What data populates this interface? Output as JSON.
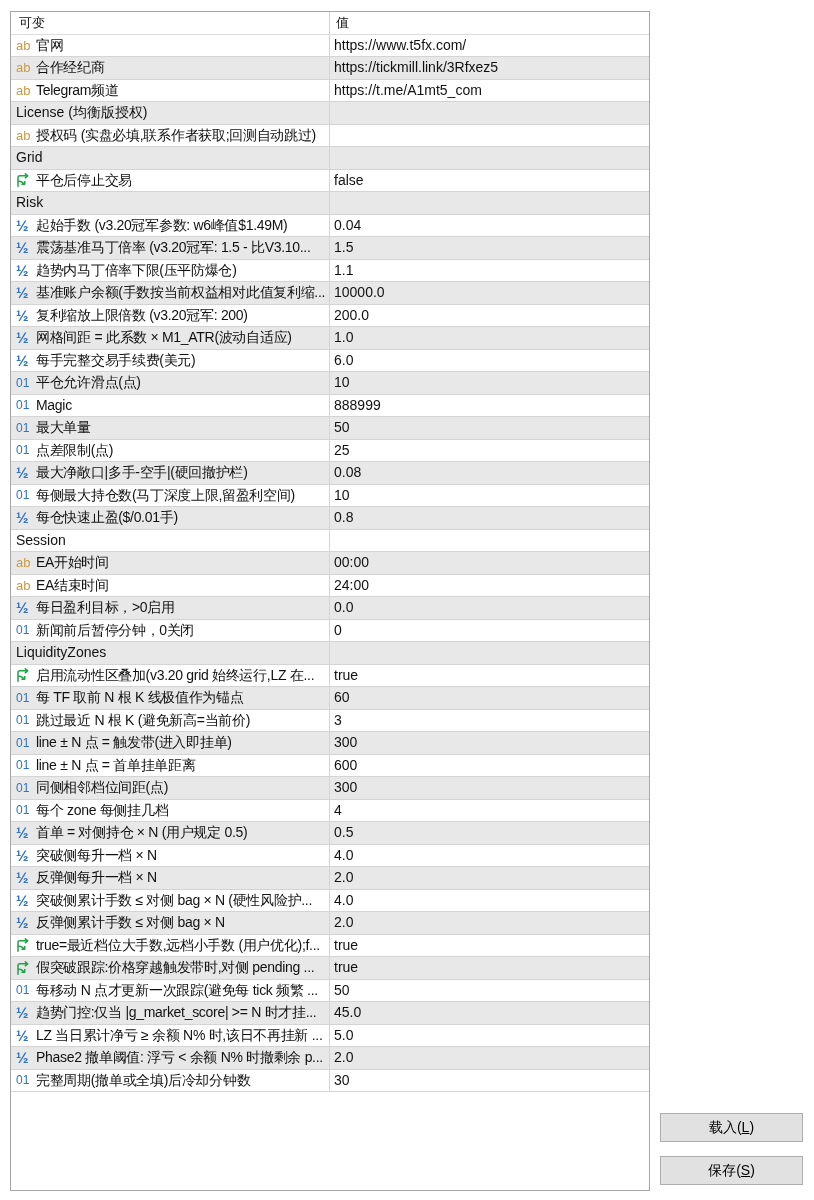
{
  "columns": [
    {
      "label": "可变"
    },
    {
      "label": "值"
    }
  ],
  "rows": [
    {
      "kind": "text",
      "type_glyph": "ab",
      "name": "官网",
      "value": "https://www.t5fx.com/"
    },
    {
      "kind": "text",
      "type_glyph": "ab",
      "name": "合作经纪商",
      "value": "https://tickmill.link/3Rfxez5"
    },
    {
      "kind": "text",
      "type_glyph": "ab",
      "name": "Telegram频道",
      "value": "https://t.me/A1mt5_com"
    },
    {
      "kind": "group",
      "name": "License (均衡版授权)"
    },
    {
      "kind": "text",
      "type_glyph": "ab",
      "name": "授权码 (实盘必填,联系作者获取;回测自动跳过)"
    },
    {
      "kind": "group",
      "name": "Grid"
    },
    {
      "kind": "boolean",
      "name": "平仓后停止交易",
      "value": "false"
    },
    {
      "kind": "group",
      "name": "Risk"
    },
    {
      "kind": "double",
      "type_glyph": "½",
      "name": "起始手数 (v3.20冠军参数: w6峰值$1.49M)",
      "value": "0.04"
    },
    {
      "kind": "double",
      "type_glyph": "½",
      "name": "震荡基准马丁倍率 (v3.20冠军: 1.5 - 比V3.10...",
      "value": "1.5"
    },
    {
      "kind": "double",
      "type_glyph": "½",
      "name": "趋势内马丁倍率下限(压平防爆仓)",
      "value": "1.1"
    },
    {
      "kind": "double",
      "type_glyph": "½",
      "name": "基准账户余额(手数按当前权益相对此值复利缩...",
      "value": "10000.0"
    },
    {
      "kind": "double",
      "type_glyph": "½",
      "name": "复利缩放上限倍数 (v3.20冠军: 200)",
      "value": "200.0"
    },
    {
      "kind": "double",
      "type_glyph": "½",
      "name": "网格间距 = 此系数 × M1_ATR(波动自适应)",
      "value": "1.0"
    },
    {
      "kind": "double",
      "type_glyph": "½",
      "name": "每手完整交易手续费(美元)",
      "value": "6.0"
    },
    {
      "kind": "integer",
      "type_glyph": "01",
      "name": "平仓允许滑点(点)",
      "value": "10"
    },
    {
      "kind": "integer",
      "type_glyph": "01",
      "name": "Magic",
      "value": "888999"
    },
    {
      "kind": "integer",
      "type_glyph": "01",
      "name": "最大单量",
      "value": "50"
    },
    {
      "kind": "integer",
      "type_glyph": "01",
      "name": "点差限制(点)",
      "value": "25"
    },
    {
      "kind": "double",
      "type_glyph": "½",
      "name": "最大净敞口|多手-空手|(硬回撤护栏)",
      "value": "0.08"
    },
    {
      "kind": "integer",
      "type_glyph": "01",
      "name": "每侧最大持仓数(马丁深度上限,留盈利空间)",
      "value": "10"
    },
    {
      "kind": "double",
      "type_glyph": "½",
      "name": "每仓快速止盈($/0.01手)",
      "value": "0.8"
    },
    {
      "kind": "group",
      "name": "Session"
    },
    {
      "kind": "text",
      "type_glyph": "ab",
      "name": "EA开始时间",
      "value": "00:00"
    },
    {
      "kind": "text",
      "type_glyph": "ab",
      "name": "EA结束时间",
      "value": "24:00"
    },
    {
      "kind": "double",
      "type_glyph": "½",
      "name": "每日盈利目标，>0启用",
      "value": "0.0"
    },
    {
      "kind": "integer",
      "type_glyph": "01",
      "name": "新闻前后暂停分钟，0关闭",
      "value": "0"
    },
    {
      "kind": "group",
      "name": "LiquidityZones"
    },
    {
      "kind": "boolean",
      "name": "启用流动性区叠加(v3.20 grid 始终运行,LZ 在...",
      "value": "true"
    },
    {
      "kind": "integer",
      "type_glyph": "01",
      "name": "每 TF 取前 N 根 K 线极值作为锚点",
      "value": "60"
    },
    {
      "kind": "integer",
      "type_glyph": "01",
      "name": "跳过最近 N 根 K (避免新高=当前价)",
      "value": "3"
    },
    {
      "kind": "integer",
      "type_glyph": "01",
      "name": "line ± N 点 = 触发带(进入即挂单)",
      "value": "300"
    },
    {
      "kind": "integer",
      "type_glyph": "01",
      "name": "line ± N 点 = 首单挂单距离",
      "value": "600"
    },
    {
      "kind": "integer",
      "type_glyph": "01",
      "name": "同侧相邻档位间距(点)",
      "value": "300"
    },
    {
      "kind": "integer",
      "type_glyph": "01",
      "name": "每个 zone 每侧挂几档",
      "value": "4"
    },
    {
      "kind": "double",
      "type_glyph": "½",
      "name": "首单 = 对侧持仓 × N (用户规定 0.5)",
      "value": "0.5"
    },
    {
      "kind": "double",
      "type_glyph": "½",
      "name": "突破侧每升一档 × N",
      "value": "4.0"
    },
    {
      "kind": "double",
      "type_glyph": "½",
      "name": "反弹侧每升一档 × N",
      "value": "2.0"
    },
    {
      "kind": "double",
      "type_glyph": "½",
      "name": "突破侧累计手数 ≤ 对侧 bag × N (硬性风险护...",
      "value": "4.0"
    },
    {
      "kind": "double",
      "type_glyph": "½",
      "name": "反弹侧累计手数 ≤ 对侧 bag × N",
      "value": "2.0"
    },
    {
      "kind": "boolean",
      "name": "true=最近档位大手数,远档小手数 (用户优化);f...",
      "value": "true"
    },
    {
      "kind": "boolean",
      "name": "假突破跟踪:价格穿越触发带时,对侧 pending ...",
      "value": "true"
    },
    {
      "kind": "integer",
      "type_glyph": "01",
      "name": "每移动 N 点才更新一次跟踪(避免每 tick 频繁 ...",
      "value": "50"
    },
    {
      "kind": "double",
      "type_glyph": "½",
      "name": "趋势门控:仅当 |g_market_score| >= N 时才挂...",
      "value": "45.0"
    },
    {
      "kind": "double",
      "type_glyph": "½",
      "name": "LZ 当日累计净亏 ≥ 余额 N% 时,该日不再挂新 ...",
      "value": "5.0"
    },
    {
      "kind": "double",
      "type_glyph": "½",
      "name": "Phase2 撤单阈值: 浮亏 < 余额 N% 时撤剩余 p...",
      "value": "2.0"
    },
    {
      "kind": "integer",
      "type_glyph": "01",
      "name": "完整周期(撤单或全填)后冷却分钟数",
      "value": "30"
    }
  ],
  "buttons": [
    {
      "label_before": "载入(",
      "mnemonic": "L",
      "label_after": ")"
    },
    {
      "label_before": "保存(",
      "mnemonic": "S",
      "label_after": ")"
    }
  ]
}
